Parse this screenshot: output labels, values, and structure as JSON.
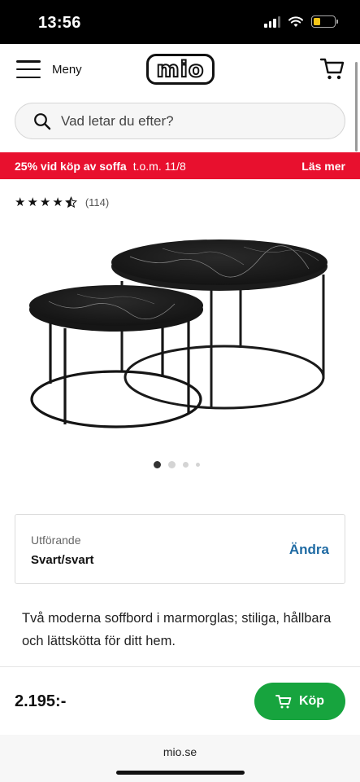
{
  "status_bar": {
    "time": "13:56"
  },
  "header": {
    "menu_label": "Meny",
    "logo_text": "mio"
  },
  "search": {
    "placeholder": "Vad letar du efter?"
  },
  "promo": {
    "text": "25% vid köp av soffa",
    "date_text": "t.o.m. 11/8",
    "link_text": "Läs mer",
    "background_color": "#e8102e"
  },
  "rating": {
    "stars_value": 4.5,
    "stars_max": 5,
    "count": "(114)"
  },
  "carousel": {
    "total_images": 4,
    "active_index": 0
  },
  "variant": {
    "label": "Utförande",
    "value": "Svart/svart",
    "change_label": "Ändra"
  },
  "description": {
    "text": "Två moderna soffbord i marmorglas; stiliga, hållbara och lättskötta för ditt hem."
  },
  "buy_bar": {
    "price": "2.195:-",
    "buy_label": "Köp",
    "buy_color": "#17a43e"
  },
  "browser": {
    "url": "mio.se"
  }
}
